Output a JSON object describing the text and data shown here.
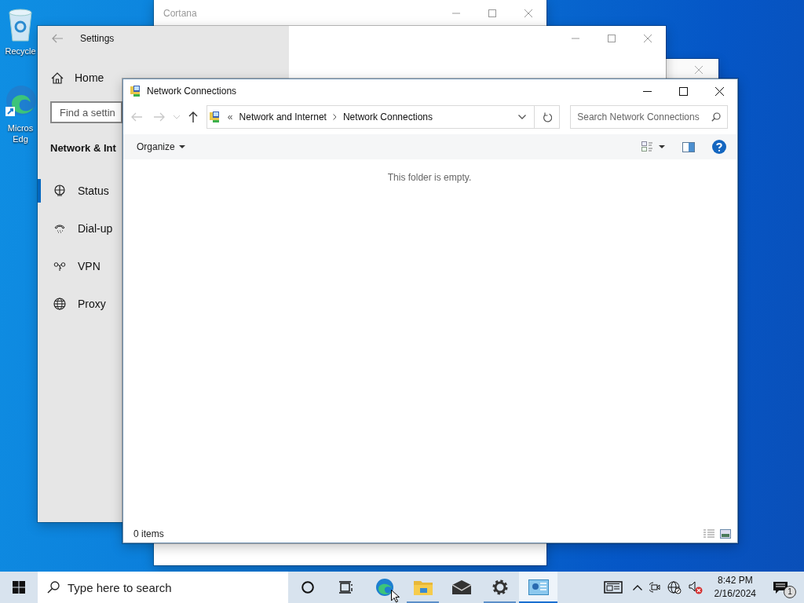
{
  "desktop_icons": [
    {
      "kind": "recycle",
      "lines": [
        "Recycle"
      ]
    },
    {
      "kind": "edge",
      "lines": [
        "Micros",
        "Edg"
      ]
    }
  ],
  "cortana_window": {
    "title": "Cortana"
  },
  "settings_window": {
    "title": "Settings",
    "home": "Home",
    "search": {
      "placeholder": "Find a settin"
    },
    "section": "Network & Int",
    "nav": [
      {
        "label": "Status",
        "kind": "globe-plug",
        "selected": true
      },
      {
        "label": "Dial-up",
        "kind": "phone",
        "selected": false
      },
      {
        "label": "VPN",
        "kind": "vpn",
        "selected": false
      },
      {
        "label": "Proxy",
        "kind": "globe",
        "selected": false
      }
    ]
  },
  "explorer_window": {
    "title": "Network Connections",
    "nav_buttons": [
      {
        "kind": "back",
        "disabled": true
      },
      {
        "kind": "forward",
        "disabled": true
      },
      {
        "kind": "recent",
        "disabled": true
      },
      {
        "kind": "up",
        "disabled": false
      }
    ],
    "address": {
      "prefix": "«",
      "crumbs": [
        "Network and Internet",
        "Network Connections"
      ]
    },
    "search": {
      "placeholder": "Search Network Connections"
    },
    "organize": "Organize",
    "empty_message": "This folder is empty.",
    "status": "0 items"
  },
  "taskbar": {
    "search": {
      "placeholder": "Type here to search"
    },
    "apps": [
      {
        "kind": "edge",
        "open": false,
        "active": false
      },
      {
        "kind": "explorer",
        "open": true,
        "active": false
      },
      {
        "kind": "mail",
        "open": false,
        "active": false
      },
      {
        "kind": "settings",
        "open": true,
        "active": false
      },
      {
        "kind": "network",
        "open": true,
        "active": true
      }
    ],
    "time": "8:42 PM",
    "date": "2/16/2024",
    "notifications": "1"
  }
}
